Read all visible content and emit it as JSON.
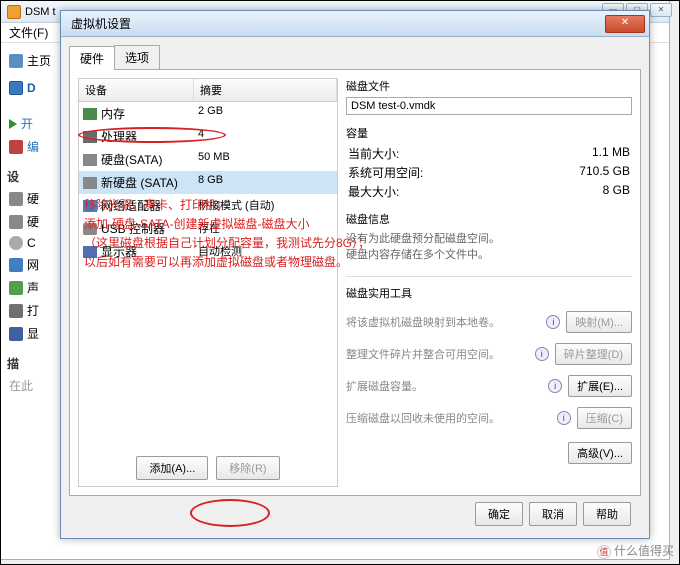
{
  "bg": {
    "title": "DSM t",
    "menu_file": "文件(F)",
    "sidebar": {
      "home": "主页",
      "dsm": "D",
      "open": "开",
      "edit": "编",
      "sec_dev": "设",
      "hdd": "硬",
      "cd": "C",
      "net": "网",
      "snd": "声",
      "prn": "打",
      "mon": "显",
      "sec_desc": "描",
      "desc_txt": "在此"
    }
  },
  "dialog": {
    "title": "虚拟机设置",
    "close": "✕",
    "tabs": {
      "hardware": "硬件",
      "options": "选项"
    },
    "table": {
      "col_device": "设备",
      "col_summary": "摘要",
      "rows": [
        {
          "icon": "di-mem",
          "name": "内存",
          "summary": "2 GB"
        },
        {
          "icon": "di-cpu",
          "name": "处理器",
          "summary": "4"
        },
        {
          "icon": "di-hdd",
          "name": "硬盘(SATA)",
          "summary": "50 MB"
        },
        {
          "icon": "di-hdd",
          "name": "新硬盘 (SATA)",
          "summary": "8 GB",
          "selected": true
        },
        {
          "icon": "di-net",
          "name": "网络适配器",
          "summary": "桥接模式 (自动)"
        },
        {
          "icon": "di-usb",
          "name": "USB 控制器",
          "summary": "存在"
        },
        {
          "icon": "di-mon",
          "name": "显示器",
          "summary": "自动检测"
        }
      ]
    },
    "annotation": {
      "l1": "移除光驱、声卡、打印机；",
      "l2": "添加-硬盘-SATA-创建新虚拟磁盘-磁盘大小",
      "l3": "（这里磁盘根据自己计划分配容量，我测试先分8G）；",
      "l4": "以后如有需要可以再添加虚拟磁盘或者物理磁盘。"
    },
    "add_btn": "添加(A)...",
    "remove_btn": "移除(R)",
    "right": {
      "disk_file_label": "磁盘文件",
      "disk_file": "DSM test-0.vmdk",
      "capacity_label": "容量",
      "current_size_k": "当前大小:",
      "current_size_v": "1.1 MB",
      "free_k": "系统可用空间:",
      "free_v": "710.5 GB",
      "max_k": "最大大小:",
      "max_v": "8 GB",
      "info_label": "磁盘信息",
      "info_txt1": "没有为此硬盘预分配磁盘空间。",
      "info_txt2": "硬盘内容存储在多个文件中。",
      "tools_label": "磁盘实用工具",
      "map_txt": "将该虚拟机磁盘映射到本地卷。",
      "map_btn": "映射(M)...",
      "defrag_txt": "整理文件碎片并整合可用空间。",
      "defrag_btn": "碎片整理(D)",
      "expand_txt": "扩展磁盘容量。",
      "expand_btn": "扩展(E)...",
      "compact_txt": "压缩磁盘以回收未使用的空间。",
      "compact_btn": "压缩(C)",
      "advanced_btn": "高级(V)..."
    },
    "ok": "确定",
    "cancel": "取消",
    "help": "帮助"
  },
  "watermark": "什么值得买"
}
